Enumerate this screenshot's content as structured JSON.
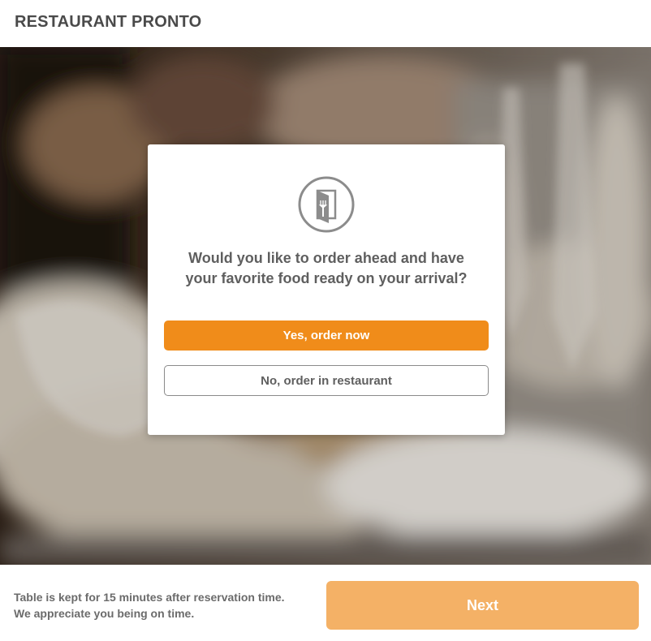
{
  "header": {
    "brand": "RESTAURANT PRONTO"
  },
  "hero": {
    "image": "blurred-restaurant-table-with-wine-glasses"
  },
  "modal": {
    "icon": "menu-cutlery-icon",
    "question_line1": "Would you like to order ahead and have",
    "question_line2": "your favorite food ready on your arrival?",
    "yes_label": "Yes, order now",
    "no_label": "No, order in restaurant"
  },
  "footer": {
    "notice_line1": "Table is kept for 15 minutes after reservation time.",
    "notice_line2": "We appreciate you being on time.",
    "next_label": "Next"
  },
  "colors": {
    "accent": "#f08c1a",
    "accent_disabled": "#f4b166",
    "text": "#5f5f5f"
  }
}
